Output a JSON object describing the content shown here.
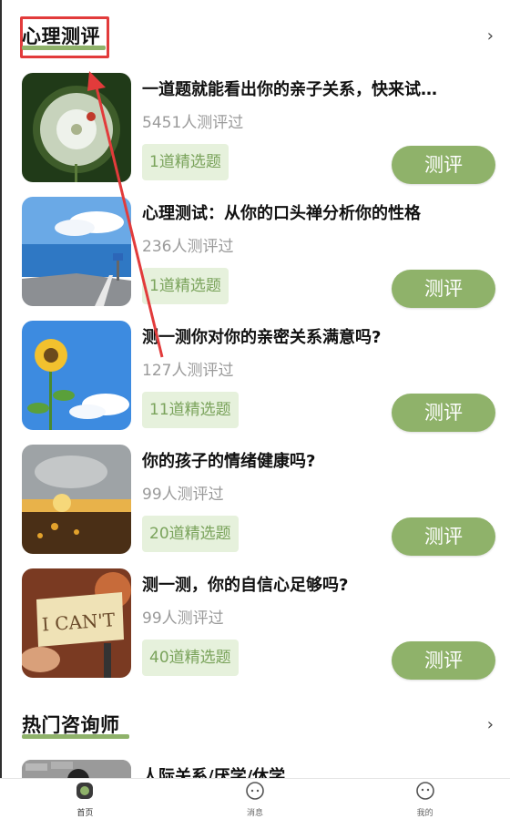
{
  "section1": {
    "title": "心理测评"
  },
  "items": [
    {
      "title": "一道题就能看出你的亲子关系，快来试…",
      "count": "5451人测评过",
      "tag": "1道精选题",
      "button": "测评"
    },
    {
      "title": "心理测试：从你的口头禅分析你的性格",
      "count": "236人测评过",
      "tag": "1道精选题",
      "button": "测评"
    },
    {
      "title": "测一测你对你的亲密关系满意吗?",
      "count": "127人测评过",
      "tag": "11道精选题",
      "button": "测评"
    },
    {
      "title": "你的孩子的情绪健康吗?",
      "count": "99人测评过",
      "tag": "20道精选题",
      "button": "测评"
    },
    {
      "title": "测一测，你的自信心足够吗?",
      "count": "99人测评过",
      "tag": "40道精选题",
      "button": "测评"
    }
  ],
  "section2": {
    "title": "热门咨询师"
  },
  "counselor": {
    "title": "人际关系/厌学/休学"
  },
  "thumb_text": {
    "i_cant": "I CAN'T"
  },
  "tabbar": [
    {
      "label": "首页",
      "icon": "home-icon"
    },
    {
      "label": "消息",
      "icon": "message-icon"
    },
    {
      "label": "我的",
      "icon": "profile-icon"
    }
  ],
  "colors": {
    "accent": "#8fb26a",
    "tag_bg": "#e6f1dc",
    "tag_text": "#7aa35b",
    "highlight": "#e23b3b"
  }
}
